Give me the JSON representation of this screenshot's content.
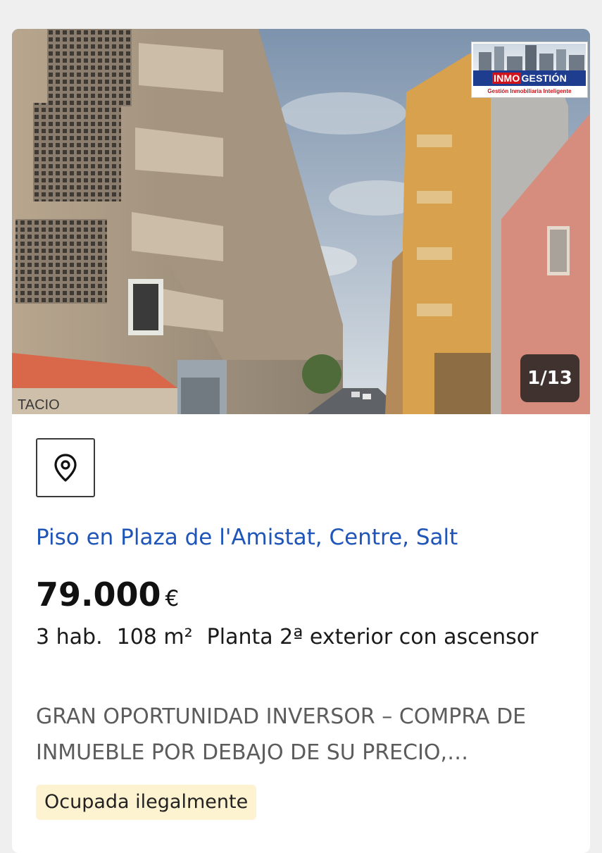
{
  "gallery": {
    "counter": "1/13",
    "logo": {
      "brand_accent": "INMO",
      "brand_rest": "GESTIÓN",
      "tagline": "Gestión Inmobiliaria Inteligente"
    },
    "sign_text": "TACIO"
  },
  "listing": {
    "title": "Piso en Plaza de l'Amistat, Centre, Salt",
    "price": "79.000",
    "currency": "€",
    "rooms": "3 hab.",
    "area": "108 m²",
    "floor": "Planta 2ª exterior con ascensor",
    "description": "GRAN OPORTUNIDAD INVERSOR – COMPRA DE INMUEBLE POR DEBAJO DE SU PRECIO,…",
    "badge": "Ocupada ilegalmente"
  },
  "icons": {
    "location": "map-pin-icon"
  },
  "colors": {
    "title": "#1f55b8",
    "badge_bg": "#fdf3d0",
    "logo_blue": "#1f3d8f",
    "logo_red": "#d0121b"
  }
}
